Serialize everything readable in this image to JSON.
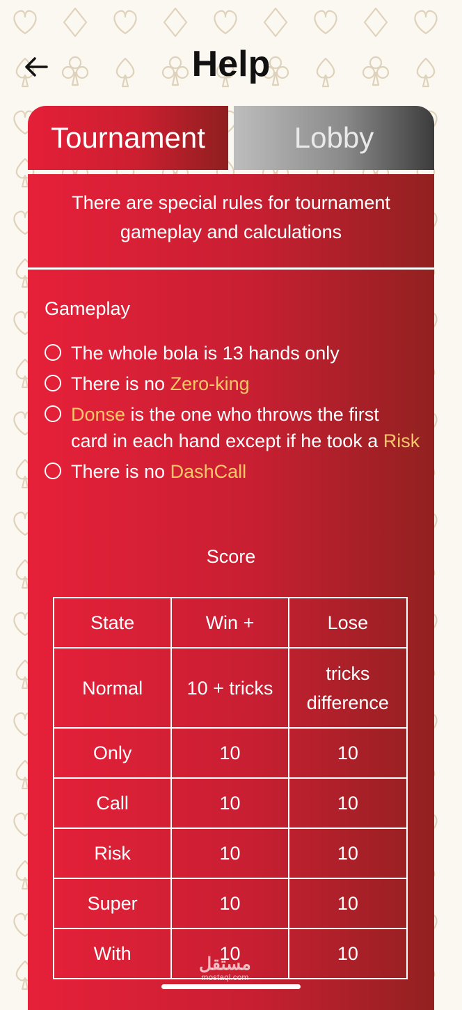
{
  "header": {
    "title": "Help"
  },
  "tabs": {
    "tournament": "Tournament",
    "lobby": "Lobby"
  },
  "intro": {
    "text": "There are special rules for tournament gameplay and calculations"
  },
  "gameplay": {
    "title": "Gameplay",
    "rules": [
      {
        "text": "The whole bola is 13 hands only"
      },
      {
        "pre": "There is no ",
        "hl": "Zero-king"
      },
      {
        "hl": "Donse",
        "post": " is the one who throws the first card in each hand except if he took a ",
        "hl2": "Risk"
      },
      {
        "pre": "There is no ",
        "hl": "DashCall"
      }
    ]
  },
  "score": {
    "title": "Score",
    "headers": [
      "State",
      "Win +",
      "Lose"
    ],
    "rows": [
      [
        "Normal",
        "10 + tricks",
        "tricks difference"
      ],
      [
        "Only",
        "10",
        "10"
      ],
      [
        "Call",
        "10",
        "10"
      ],
      [
        "Risk",
        "10",
        "10"
      ],
      [
        "Super",
        "10",
        "10"
      ],
      [
        "With",
        "10",
        "10"
      ]
    ]
  },
  "watermark": {
    "main": "مستقل",
    "sub": "mostaql.com"
  },
  "colors": {
    "accent": "#e41f38",
    "accent_dark": "#8f1f1f",
    "highlight": "#f7c66b",
    "pattern": "#d8cbb3"
  },
  "icons": {
    "back": "arrow-left-icon"
  }
}
